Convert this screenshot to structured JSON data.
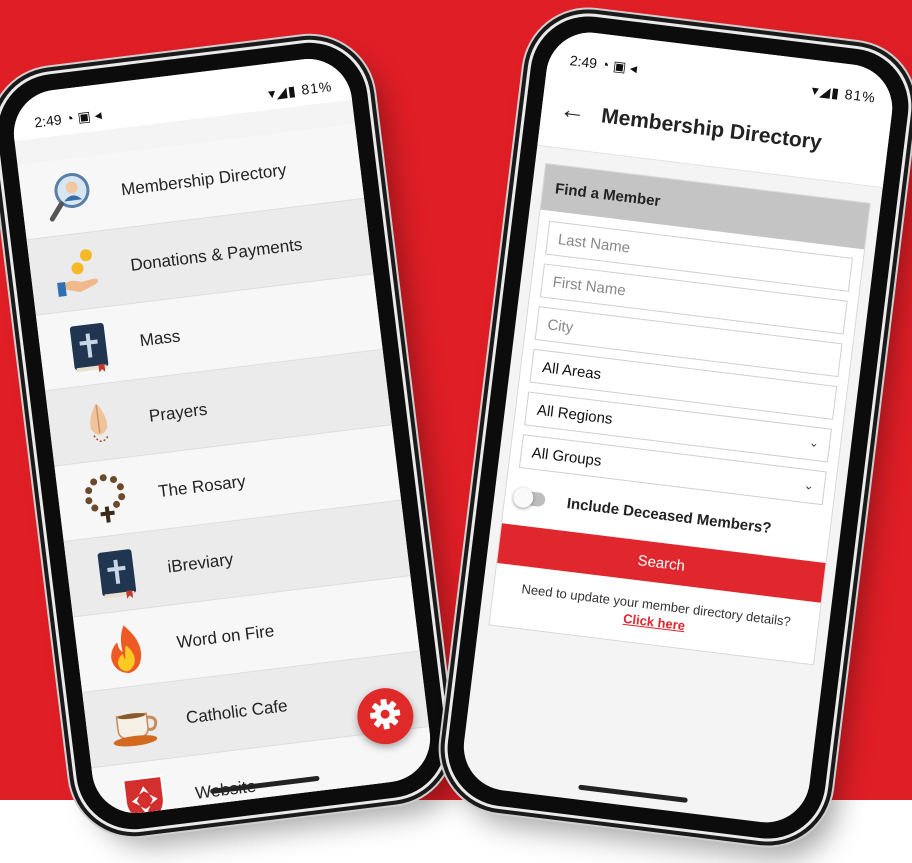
{
  "left_phone": {
    "status": {
      "time": "2:49",
      "notif_icons": "◔ ▣ ◂",
      "right_icons": "▾◢▮",
      "battery": "81%"
    },
    "menu": [
      {
        "label": "Membership Directory",
        "icon": "member-search-icon"
      },
      {
        "label": "Donations & Payments",
        "icon": "coins-hand-icon"
      },
      {
        "label": "Mass",
        "icon": "bible-icon"
      },
      {
        "label": "Prayers",
        "icon": "praying-hands-icon"
      },
      {
        "label": "The Rosary",
        "icon": "rosary-icon"
      },
      {
        "label": "iBreviary",
        "icon": "bible-icon"
      },
      {
        "label": "Word on Fire",
        "icon": "fire-icon"
      },
      {
        "label": "Catholic Cafe",
        "icon": "coffee-cup-icon"
      },
      {
        "label": "Website",
        "icon": "maltese-cross-shield-icon"
      }
    ],
    "fab_icon": "gear-icon"
  },
  "right_phone": {
    "status": {
      "time": "2:49",
      "notif_icons": "◔ ▣ ◂",
      "right_icons": "▾◢▮",
      "battery": "81%"
    },
    "appbar": {
      "back_icon": "←",
      "title": "Membership Directory"
    },
    "form": {
      "heading": "Find a Member",
      "last_name_placeholder": "Last Name",
      "first_name_placeholder": "First Name",
      "city_placeholder": "City",
      "area_value": "All Areas",
      "region_value": "All Regions",
      "group_value": "All Groups",
      "deceased_label": "Include Deceased Members?",
      "deceased_on": false,
      "search_label": "Search"
    },
    "update_text": "Need to update your member directory details?",
    "click_here": "Click here"
  },
  "colors": {
    "brand_red": "#e01e26",
    "header_gray": "#c4c4c4"
  }
}
